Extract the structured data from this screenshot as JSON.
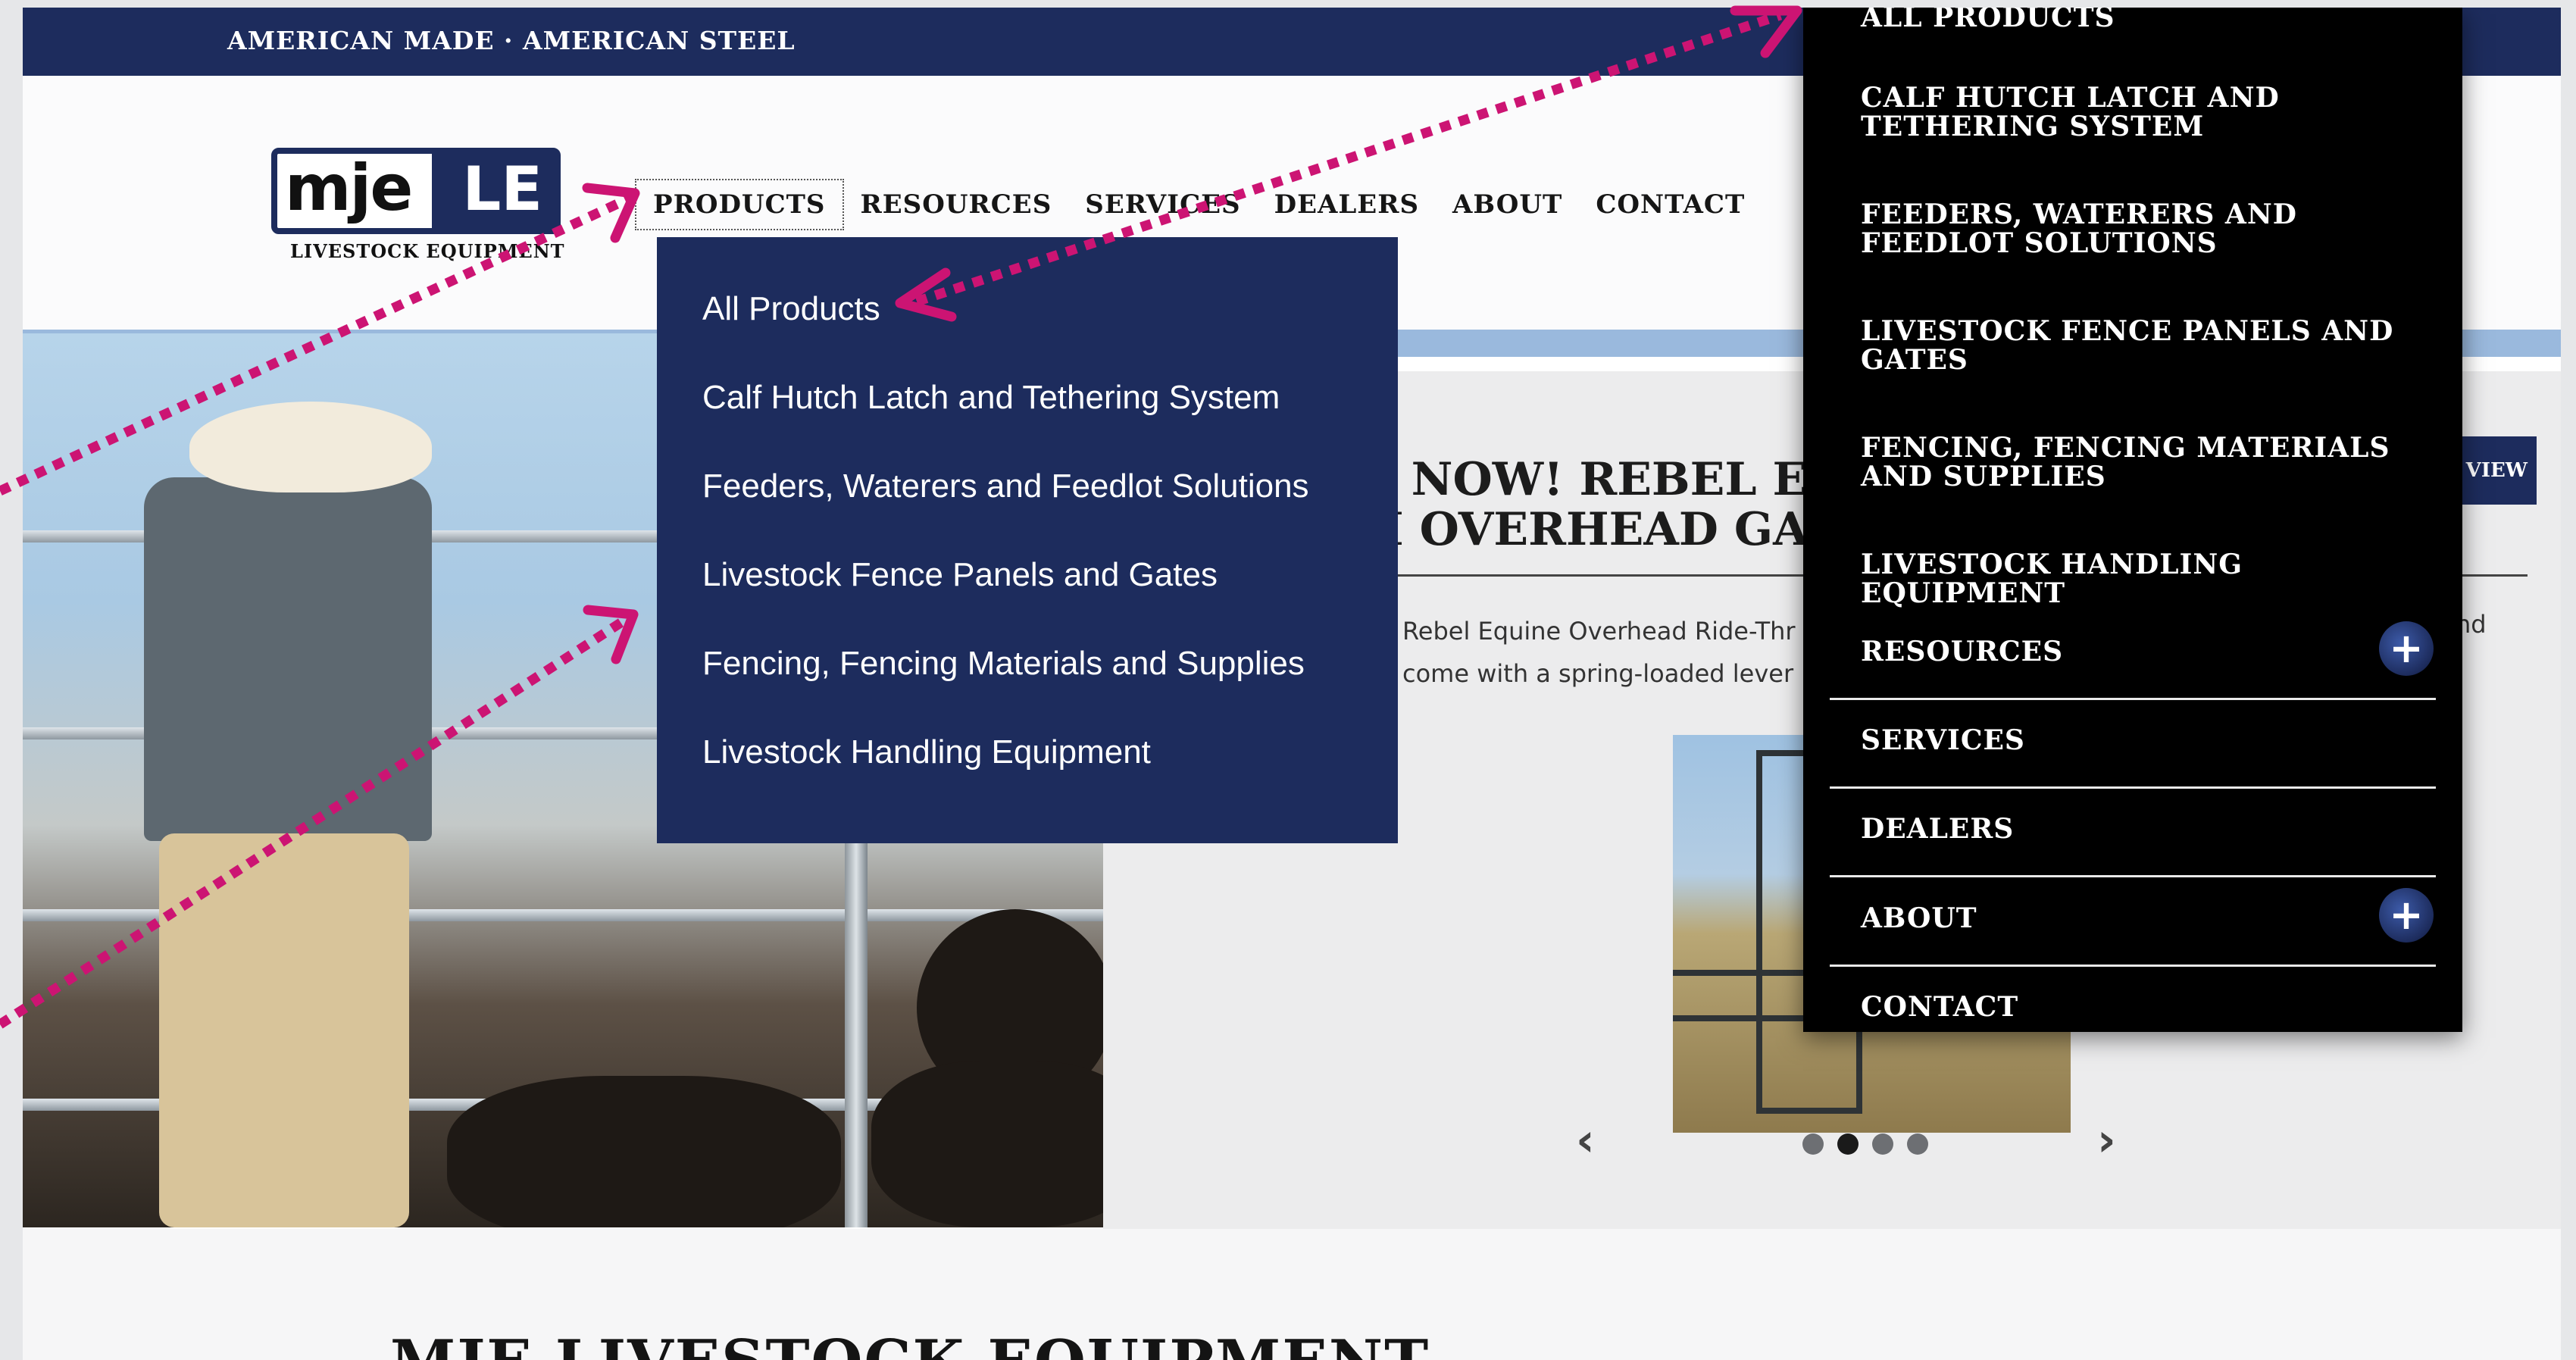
{
  "topbar": {
    "tagline": "AMERICAN MADE · AMERICAN STEEL"
  },
  "logo": {
    "mark_left": "mje",
    "mark_right": "LE",
    "subtitle": "LIVESTOCK EQUIPMENT"
  },
  "nav": {
    "products": "PRODUCTS",
    "resources": "RESOURCES",
    "services": "SERVICES",
    "dealers": "DEALERS",
    "about": "ABOUT",
    "contact": "CONTACT"
  },
  "dropdown": {
    "items": [
      "All Products",
      "Calf Hutch Latch and Tethering System",
      "Feeders, Waterers and Feedlot Solutions",
      "Livestock Fence Panels and Gates",
      "Fencing, Fencing Materials and Supplies",
      "Livestock Handling Equipment"
    ]
  },
  "feature": {
    "headline_line1": "E NOW! REBEL EQU",
    "headline_line2": "H OVERHEAD GAT",
    "desc_line1": "Rebel Equine Overhead Ride-Thr",
    "desc_line2": "come with a spring-loaded lever",
    "desc_tail": "nd",
    "view_button": "VIEW",
    "prev_arrow": "‹",
    "next_arrow": "›",
    "slide_count": 4,
    "active_slide": 2
  },
  "bottom": {
    "section_title": "MJE LIVESTOCK EQUIPMENT"
  },
  "mobile_menu": {
    "all_products": "ALL PRODUCTS",
    "calf_hutch": "CALF HUTCH LATCH AND TETHERING SYSTEM",
    "feeders": "FEEDERS, WATERERS AND FEEDLOT SOLUTIONS",
    "fence_panels": "LIVESTOCK FENCE PANELS AND GATES",
    "fencing": "FENCING, FENCING MATERIALS AND SUPPLIES",
    "handling": "LIVESTOCK HANDLING EQUIPMENT",
    "resources": "RESOURCES",
    "services": "SERVICES",
    "dealers": "DEALERS",
    "about": "ABOUT",
    "contact": "CONTACT",
    "expand_symbol": "+"
  },
  "colors": {
    "navy": "#1d2c5d",
    "annotation_pink": "#cc1473",
    "menu_black": "#000000"
  }
}
